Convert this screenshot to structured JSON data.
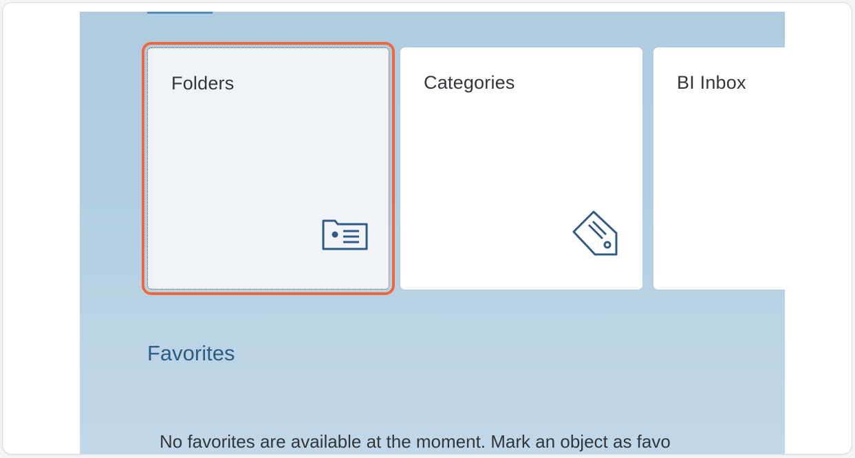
{
  "tiles": [
    {
      "title": "Folders",
      "icon": "folder-icon",
      "focused": true
    },
    {
      "title": "Categories",
      "icon": "tag-icon",
      "focused": false
    },
    {
      "title": "BI Inbox",
      "icon": "inbox-icon",
      "focused": false
    }
  ],
  "favorites": {
    "heading": "Favorites",
    "empty_message": "No favorites are available at the moment. Mark an object as favo"
  },
  "colors": {
    "shell_background": "#b2cee2",
    "tile_background": "#ffffff",
    "focus_outline": "#f0683a",
    "icon_color": "#2e5a84",
    "heading_color": "#2f5d80"
  }
}
